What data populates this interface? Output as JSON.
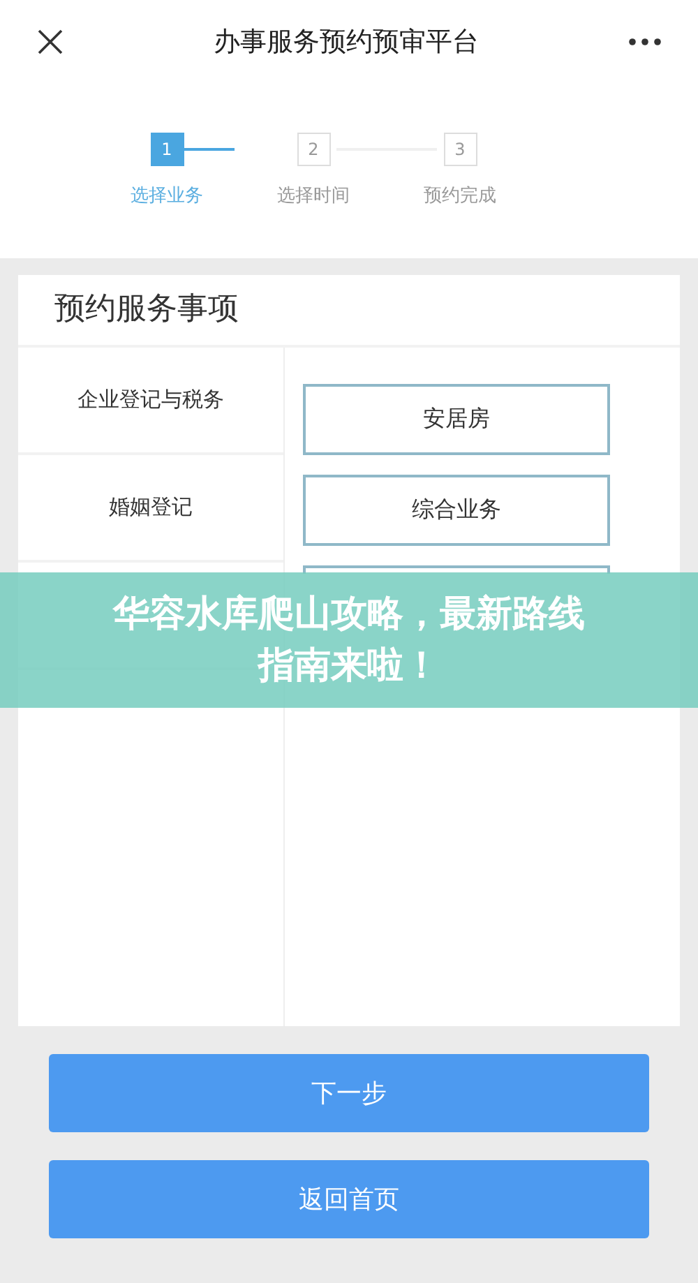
{
  "header": {
    "title": "办事服务预约预审平台"
  },
  "steps": [
    {
      "number": "1",
      "label": "选择业务",
      "selected": true
    },
    {
      "number": "2",
      "label": "选择时间",
      "selected": false
    },
    {
      "number": "3",
      "label": "预约完成",
      "selected": false
    }
  ],
  "card": {
    "title": "预约服务事项",
    "categories": [
      {
        "label": "企业登记与税务",
        "selected": false
      },
      {
        "label": "婚姻登记",
        "selected": false
      }
    ],
    "services": [
      {
        "label": "安居房"
      },
      {
        "label": "综合业务"
      }
    ]
  },
  "buttons": [
    "下一步",
    "返回首页"
  ],
  "banner": {
    "text": "华容水库爬山攻略，最新路线指南来啦！"
  }
}
